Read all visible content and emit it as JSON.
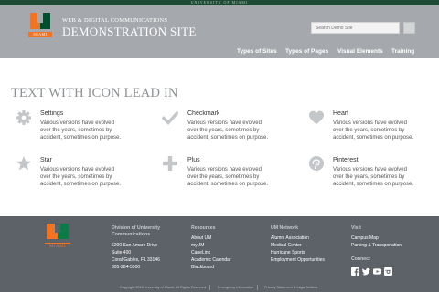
{
  "topbar": {
    "label": "UNIVERSITY OF MIAMI"
  },
  "header": {
    "logo_text": "MIAMI",
    "subtitle": "WEB & DIGITAL COMMUNICATIONS",
    "title": "DEMONSTRATION SITE",
    "search_placeholder": "Search Demo Site",
    "nav": [
      "Types of Sites",
      "Types of Pages",
      "Visual Elements",
      "Training"
    ]
  },
  "main": {
    "title": "TEXT WITH ICON LEAD IN",
    "features": [
      {
        "icon": "gear-icon",
        "title": "Settings",
        "desc": "Various versions have evolved over the years, sometimes by accident, sometimes on purpose."
      },
      {
        "icon": "checkmark-icon",
        "title": "Checkmark",
        "desc": "Various versions have evolved over the years, sometimes by accident, sometimes on purpose."
      },
      {
        "icon": "heart-icon",
        "title": "Heart",
        "desc": "Various versions have evolved over the years, sometimes by accident, sometimes on purpose."
      },
      {
        "icon": "star-icon",
        "title": "Star",
        "desc": "Various versions have evolved over the years, sometimes by accident, sometimes on purpose."
      },
      {
        "icon": "plus-icon",
        "title": "Plus",
        "desc": "Various versions have evolved over the years, sometimes by accident, sometimes on purpose."
      },
      {
        "icon": "pinterest-icon",
        "title": "Pinterest",
        "desc": "Various versions have evolved over the years, sometimes by accident, sometimes on purpose."
      }
    ]
  },
  "footer": {
    "logo_text": "MIAMI",
    "org": {
      "line1": "Division of University",
      "line2": "Communications"
    },
    "address": [
      "6200 San Amaro Drive",
      "Suite 400",
      "Coral Gables, FL 33146",
      "305-284-5500"
    ],
    "resources": {
      "title": "Resources",
      "links": [
        "About UM",
        "myUM",
        "CaneLink",
        "Academic Calendar",
        "Blackboard"
      ]
    },
    "network": {
      "title": "UM Network",
      "links": [
        "Alumni Association",
        "Medical Center",
        "Hurricane Sports",
        "Employment Opportunities"
      ]
    },
    "visit": {
      "title": "Visit",
      "links": [
        "Campus Map",
        "Parking & Transportation"
      ]
    },
    "connect": {
      "title": "Connect",
      "icons": [
        "facebook-icon",
        "twitter-icon",
        "youtube-icon",
        "instagram-icon"
      ]
    },
    "copyright": "Copyright 2015 University of Miami. All Rights Reserved.",
    "bottom_links": [
      "Emergency Information",
      "Privacy Statement & Legal Notices"
    ]
  },
  "colors": {
    "header_bg": "#a5a9ad",
    "top_strip": "#1f4a36",
    "footer_bg": "#5d6269",
    "icon_gray": "#c4c7ca",
    "brand_orange": "#f47321",
    "brand_green": "#005030"
  }
}
